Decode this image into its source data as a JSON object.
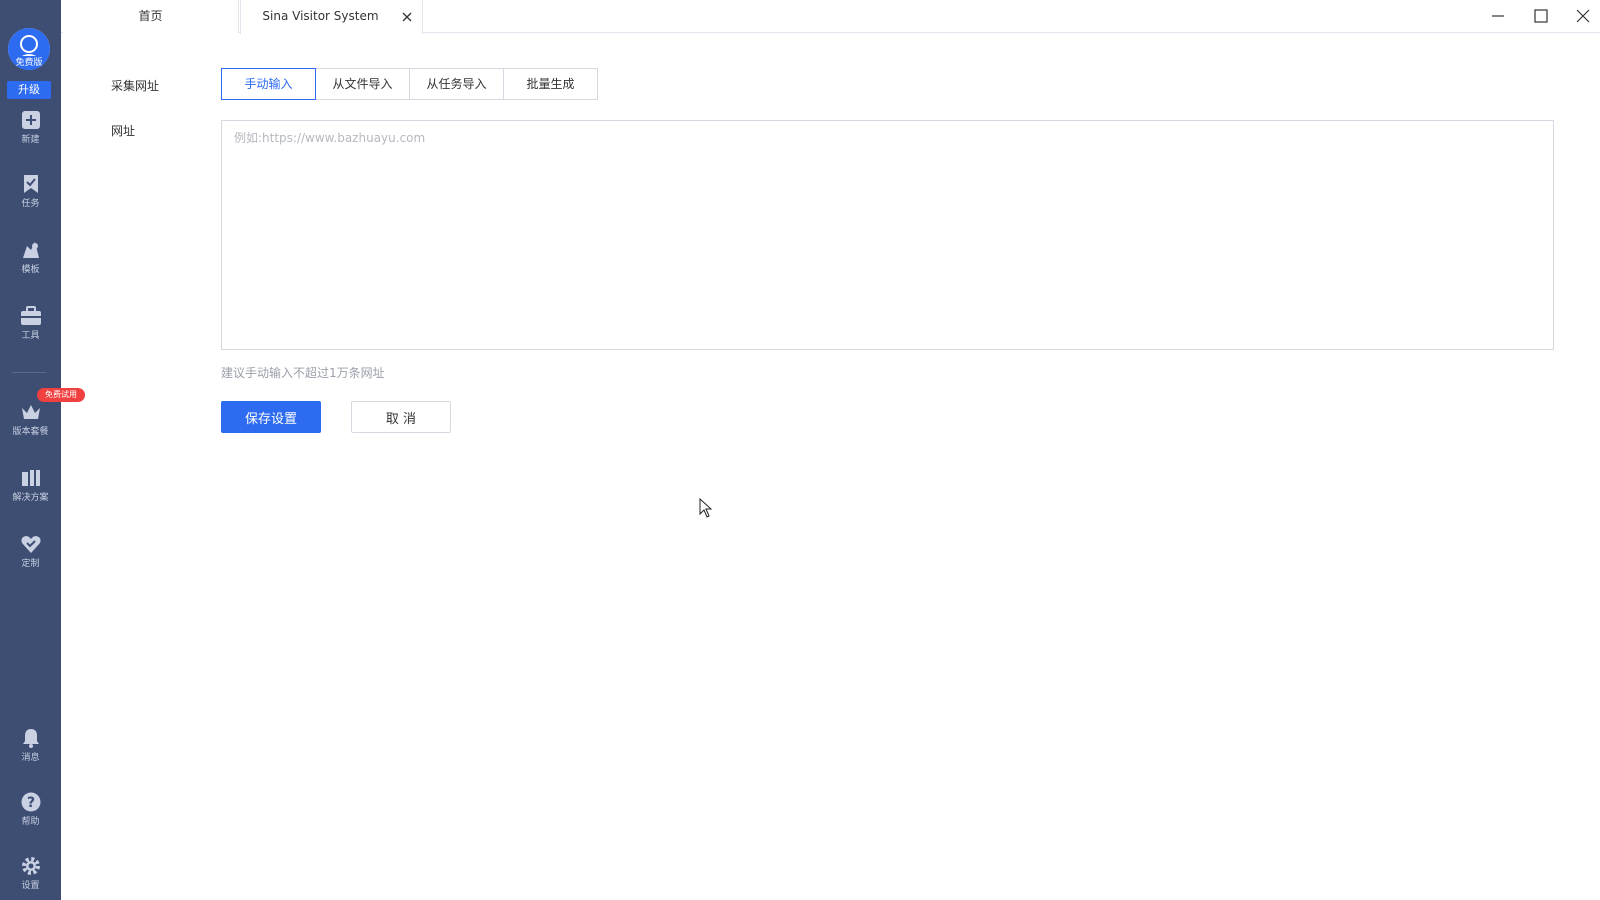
{
  "sidebar": {
    "avatar_badge": "免费版",
    "upgrade_label": "升级",
    "items": [
      {
        "label": "新建",
        "icon": "plus-square-icon"
      },
      {
        "label": "任务",
        "icon": "bookmark-check-icon"
      },
      {
        "label": "模板",
        "icon": "template-icon"
      },
      {
        "label": "工具",
        "icon": "toolbox-icon"
      },
      {
        "label": "版本套餐",
        "icon": "crown-icon"
      },
      {
        "label": "解决方案",
        "icon": "solution-icon"
      },
      {
        "label": "定制",
        "icon": "heart-check-icon"
      },
      {
        "label": "消息",
        "icon": "bell-icon"
      },
      {
        "label": "帮助",
        "icon": "help-icon"
      },
      {
        "label": "设置",
        "icon": "gear-icon"
      }
    ],
    "trial_badge": "免费试用"
  },
  "tabs": {
    "home": "首页",
    "active": "Sina Visitor System"
  },
  "form": {
    "collect_label": "采集网址",
    "segments": [
      "手动输入",
      "从文件导入",
      "从任务导入",
      "批量生成"
    ],
    "active_segment": "手动输入",
    "url_label": "网址",
    "url_placeholder": "例如:https://www.bazhuayu.com",
    "url_value": "",
    "hint": "建议手动输入不超过1万条网址",
    "save_label": "保存设置",
    "cancel_label": "取 消"
  },
  "colors": {
    "sidebar_bg": "#3e4e73",
    "accent": "#2d6bf0",
    "badge_red": "#f04040"
  }
}
